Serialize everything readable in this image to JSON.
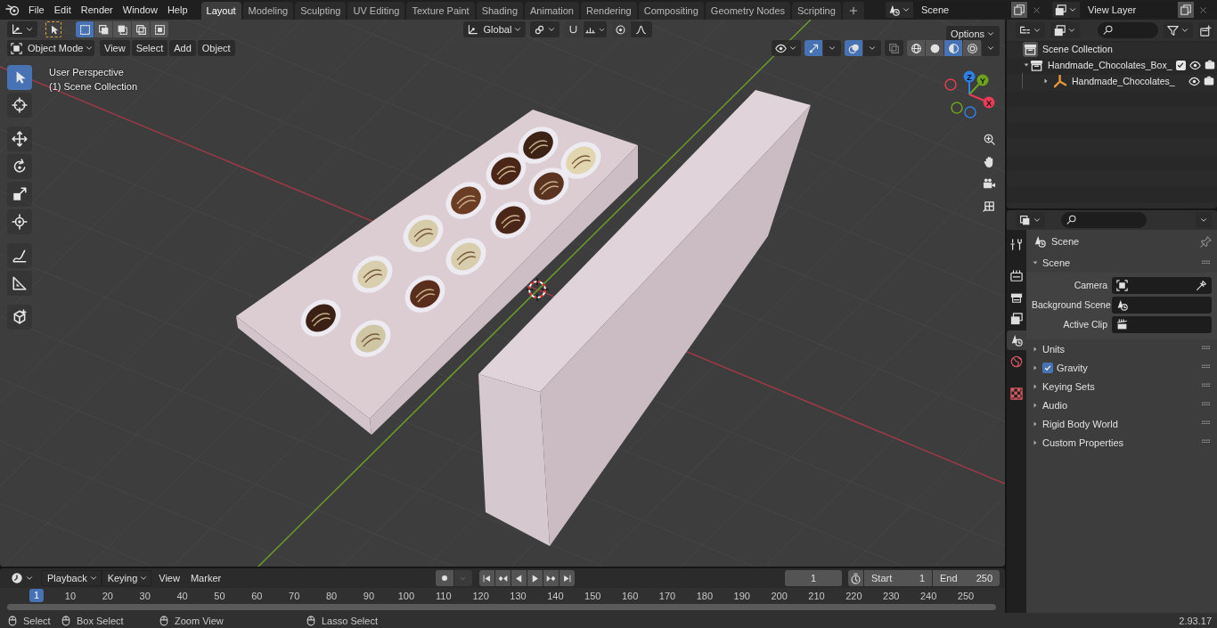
{
  "top_bar": {
    "menus": [
      "File",
      "Edit",
      "Render",
      "Window",
      "Help"
    ],
    "workspaces": [
      {
        "label": "Layout",
        "selected": true
      },
      {
        "label": "Modeling",
        "selected": false
      },
      {
        "label": "Sculpting",
        "selected": false
      },
      {
        "label": "UV Editing",
        "selected": false
      },
      {
        "label": "Texture Paint",
        "selected": false
      },
      {
        "label": "Shading",
        "selected": false
      },
      {
        "label": "Animation",
        "selected": false
      },
      {
        "label": "Rendering",
        "selected": false
      },
      {
        "label": "Compositing",
        "selected": false
      },
      {
        "label": "Geometry Nodes",
        "selected": false
      },
      {
        "label": "Scripting",
        "selected": false
      }
    ],
    "scene": "Scene",
    "view_layer": "View Layer"
  },
  "viewport": {
    "select_modes": [
      {
        "selected": true
      },
      {
        "selected": false
      },
      {
        "selected": false
      },
      {
        "selected": false
      },
      {
        "selected": false
      }
    ],
    "transform_orientation": "Global",
    "options_button": "Options",
    "mode": "Object Mode",
    "menus": [
      "View",
      "Select",
      "Add",
      "Object"
    ],
    "shading_modes": [
      {
        "selected": false
      },
      {
        "selected": false
      },
      {
        "selected": true
      },
      {
        "selected": false
      }
    ],
    "overlay_lines": [
      "User Perspective",
      "(1) Scene Collection"
    ],
    "tools": [
      {
        "kind": "select",
        "selected": true
      },
      {
        "kind": "cursor",
        "selected": false
      },
      {
        "kind": "move",
        "selected": false
      },
      {
        "kind": "rotate",
        "selected": false
      },
      {
        "kind": "scale",
        "selected": false
      },
      {
        "kind": "transform",
        "selected": false
      },
      {
        "kind": "annotate",
        "selected": false
      },
      {
        "kind": "measure",
        "selected": false
      },
      {
        "kind": "add_cube",
        "selected": false
      }
    ],
    "gizmo_axes": [
      {
        "label": "Z",
        "color": "#2f80e6"
      },
      {
        "label": "Y",
        "color": "#6ea21c"
      },
      {
        "label": "X",
        "color": "#e63c55"
      }
    ]
  },
  "outliner": {
    "items": [
      {
        "name": "Scene Collection",
        "kind": "scene_collection",
        "children": [
          {
            "name": "Handmade_Chocolates_Box_",
            "kind": "collection",
            "expanded": true,
            "checked": true,
            "children": [
              {
                "name": "Handmade_Chocolates_",
                "kind": "object",
                "expanded": false
              }
            ]
          }
        ]
      }
    ]
  },
  "properties": {
    "tabs": [
      {
        "kind": "tool",
        "selected": false
      },
      {
        "kind": "render",
        "selected": false
      },
      {
        "kind": "output",
        "selected": false
      },
      {
        "kind": "view_layer",
        "selected": false
      },
      {
        "kind": "scene",
        "selected": true
      },
      {
        "kind": "world",
        "selected": false
      },
      {
        "kind": "texture",
        "selected": false
      }
    ],
    "context": "Scene",
    "panel": {
      "title": "Scene",
      "expanded": true,
      "fields": [
        {
          "label": "Camera",
          "kind": "object"
        },
        {
          "label": "Background Scene",
          "kind": "scene"
        },
        {
          "label": "Active Clip",
          "kind": "clip"
        }
      ]
    },
    "subpanels": [
      {
        "title": "Units",
        "kind": "plain",
        "expanded": false
      },
      {
        "title": "Gravity",
        "kind": "checkbox",
        "checked": true,
        "expanded": false
      },
      {
        "title": "Keying Sets",
        "kind": "plain",
        "expanded": false
      },
      {
        "title": "Audio",
        "kind": "plain",
        "expanded": false
      },
      {
        "title": "Rigid Body World",
        "kind": "plain",
        "expanded": false
      },
      {
        "title": "Custom Properties",
        "kind": "plain",
        "expanded": false
      }
    ]
  },
  "timeline": {
    "dropdowns": [
      "Playback",
      "Keying"
    ],
    "menus": [
      "View",
      "Marker"
    ],
    "current_frame": "1",
    "start_label": "Start",
    "start": "1",
    "end_label": "End",
    "end": "250",
    "playhead": "1",
    "ruler": [
      "10",
      "20",
      "30",
      "40",
      "50",
      "60",
      "70",
      "80",
      "90",
      "100",
      "110",
      "120",
      "130",
      "140",
      "150",
      "160",
      "170",
      "180",
      "190",
      "200",
      "210",
      "220",
      "230",
      "240",
      "250"
    ]
  },
  "status_bar": {
    "hints": [
      "Select",
      "Box Select",
      "Zoom View",
      "Lasso Select"
    ],
    "version": "2.93.17"
  }
}
